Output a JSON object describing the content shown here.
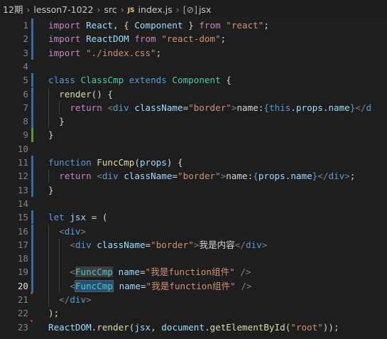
{
  "breadcrumb": {
    "items": [
      "12期",
      "lesson7-1022",
      "src"
    ],
    "file_badge": "JS",
    "file": "index.js",
    "symbol_icon": "[⊘]",
    "symbol": "jsx"
  },
  "lines": [
    {
      "n": "1",
      "tokens": [
        [
          "ctrl",
          "import "
        ],
        [
          "var",
          "React"
        ],
        [
          "pl",
          ", { "
        ],
        [
          "var",
          "Component"
        ],
        [
          "pl",
          " } "
        ],
        [
          "ctrl",
          "from "
        ],
        [
          "str",
          "\"react\""
        ],
        [
          "pl",
          ";"
        ]
      ]
    },
    {
      "n": "2",
      "tokens": [
        [
          "ctrl",
          "import "
        ],
        [
          "var",
          "ReactDOM "
        ],
        [
          "ctrl",
          "from "
        ],
        [
          "str",
          "\"react-dom\""
        ],
        [
          "pl",
          ";"
        ]
      ]
    },
    {
      "n": "3",
      "tokens": [
        [
          "ctrl",
          "import "
        ],
        [
          "str",
          "\"./index.css\""
        ],
        [
          "pl",
          ";"
        ]
      ]
    },
    {
      "n": "4",
      "tokens": []
    },
    {
      "n": "5",
      "tokens": [
        [
          "kw",
          "class "
        ],
        [
          "cls",
          "ClassCmp "
        ],
        [
          "kw",
          "extends "
        ],
        [
          "cls",
          "Component "
        ],
        [
          "pl",
          "{"
        ]
      ]
    },
    {
      "n": "6",
      "tokens": [
        [
          "pl",
          "  "
        ],
        [
          "fn",
          "render"
        ],
        [
          "pl",
          "() {"
        ]
      ]
    },
    {
      "n": "7",
      "tokens": [
        [
          "pl",
          "    "
        ],
        [
          "ctrl",
          "return "
        ],
        [
          "tag",
          "<"
        ],
        [
          "kw",
          "div "
        ],
        [
          "var",
          "className"
        ],
        [
          "pl",
          "="
        ],
        [
          "str",
          "\"border\""
        ],
        [
          "tag",
          ">"
        ],
        [
          "pl",
          "name:"
        ],
        [
          "kw",
          "{"
        ],
        [
          "kw",
          "this"
        ],
        [
          "pl",
          "."
        ],
        [
          "var",
          "props"
        ],
        [
          "pl",
          "."
        ],
        [
          "var",
          "name"
        ],
        [
          "kw",
          "}"
        ],
        [
          "tag",
          "</"
        ],
        [
          "kw",
          "d"
        ]
      ]
    },
    {
      "n": "8",
      "tokens": [
        [
          "pl",
          "  }"
        ]
      ]
    },
    {
      "n": "9",
      "tokens": [
        [
          "pl",
          "}"
        ]
      ]
    },
    {
      "n": "10",
      "tokens": []
    },
    {
      "n": "11",
      "tokens": [
        [
          "kw",
          "function "
        ],
        [
          "fn",
          "FuncCmp"
        ],
        [
          "pl",
          "("
        ],
        [
          "var",
          "props"
        ],
        [
          "pl",
          ") {"
        ]
      ]
    },
    {
      "n": "12",
      "tokens": [
        [
          "pl",
          "  "
        ],
        [
          "ctrl",
          "return "
        ],
        [
          "tag",
          "<"
        ],
        [
          "kw",
          "div "
        ],
        [
          "var",
          "className"
        ],
        [
          "pl",
          "="
        ],
        [
          "str",
          "\"border\""
        ],
        [
          "tag",
          ">"
        ],
        [
          "pl",
          "name:"
        ],
        [
          "kw",
          "{"
        ],
        [
          "var",
          "props"
        ],
        [
          "pl",
          "."
        ],
        [
          "var",
          "name"
        ],
        [
          "kw",
          "}"
        ],
        [
          "tag",
          "</"
        ],
        [
          "kw",
          "div"
        ],
        [
          "tag",
          ">"
        ],
        [
          "pl",
          ";"
        ]
      ]
    },
    {
      "n": "13",
      "tokens": [
        [
          "pl",
          "}"
        ]
      ]
    },
    {
      "n": "14",
      "tokens": []
    },
    {
      "n": "15",
      "tokens": [
        [
          "kw",
          "let "
        ],
        [
          "var",
          "jsx "
        ],
        [
          "pl",
          "= ("
        ]
      ]
    },
    {
      "n": "16",
      "tokens": [
        [
          "pl",
          "  "
        ],
        [
          "tag",
          "<"
        ],
        [
          "kw",
          "div"
        ],
        [
          "tag",
          ">"
        ]
      ]
    },
    {
      "n": "17",
      "tokens": [
        [
          "pl",
          "    "
        ],
        [
          "tag",
          "<"
        ],
        [
          "kw",
          "div "
        ],
        [
          "var",
          "className"
        ],
        [
          "pl",
          "="
        ],
        [
          "str",
          "\"border\""
        ],
        [
          "tag",
          ">"
        ],
        [
          "pl",
          "我是内容"
        ],
        [
          "tag",
          "</"
        ],
        [
          "kw",
          "div"
        ],
        [
          "tag",
          ">"
        ]
      ]
    },
    {
      "n": "18",
      "tokens": []
    },
    {
      "n": "19",
      "tokens": [
        [
          "pl",
          "    "
        ],
        [
          "tag",
          "<"
        ],
        [
          "cls hl",
          "FuncCmp"
        ],
        [
          "pl",
          " "
        ],
        [
          "var",
          "name"
        ],
        [
          "pl",
          "="
        ],
        [
          "str",
          "\"我是function组件\""
        ],
        [
          "pl",
          " "
        ],
        [
          "tag",
          "/>"
        ]
      ]
    },
    {
      "n": "20",
      "tokens": [
        [
          "pl",
          "    "
        ],
        [
          "tag",
          "<"
        ],
        [
          "cls sel",
          "FuncCmp"
        ],
        [
          "cursor",
          ""
        ],
        [
          "pl",
          " "
        ],
        [
          "var",
          "name"
        ],
        [
          "pl",
          "="
        ],
        [
          "str",
          "\"我是function组件\""
        ],
        [
          "pl",
          " "
        ],
        [
          "tag",
          "/>"
        ]
      ]
    },
    {
      "n": "21",
      "tokens": [
        [
          "pl",
          "  "
        ],
        [
          "tag",
          "</"
        ],
        [
          "kw",
          "div"
        ],
        [
          "tag",
          ">"
        ]
      ]
    },
    {
      "n": "22",
      "tokens": [
        [
          "pl",
          ");"
        ]
      ]
    },
    {
      "n": "23",
      "tokens": [
        [
          "var",
          "ReactDOM"
        ],
        [
          "pl",
          "."
        ],
        [
          "fn",
          "render"
        ],
        [
          "pl",
          "("
        ],
        [
          "var",
          "jsx"
        ],
        [
          "pl",
          ", "
        ],
        [
          "var",
          "document"
        ],
        [
          "pl",
          "."
        ],
        [
          "fn",
          "getElementById"
        ],
        [
          "pl",
          "("
        ],
        [
          "str",
          "\"root\""
        ],
        [
          "pl",
          "));"
        ]
      ]
    }
  ],
  "active_line": "20",
  "modified_lines": [
    "1",
    "2",
    "3",
    "5",
    "6",
    "7",
    "8",
    "11",
    "12",
    "13",
    "15",
    "16",
    "17",
    "18",
    "19",
    "20"
  ],
  "added_lines": [
    "9"
  ],
  "deleted_markers_after": [
    "20",
    "22"
  ]
}
